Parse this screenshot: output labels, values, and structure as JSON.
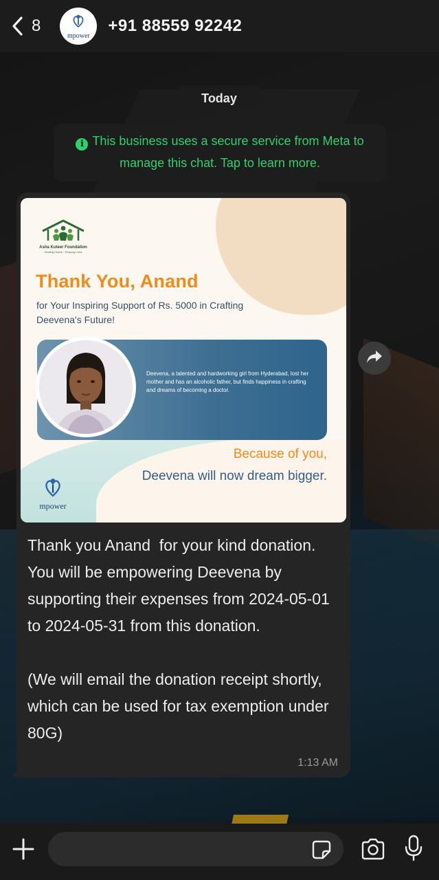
{
  "header": {
    "back_count": "8",
    "avatar_brand": "mpower",
    "title": "+91 88559 92242",
    "icons": {
      "back": "chevron-left-icon",
      "avatar": "mpower-logo-icon"
    }
  },
  "chat": {
    "date_label": "Today",
    "notice": {
      "icon": "info-icon",
      "text": "This business uses a secure service from Meta to manage this chat. Tap to learn more.",
      "color": "#2fd16d"
    },
    "message": {
      "card": {
        "org_name": "Asha Kuteer Foundation",
        "org_tagline": "Healing Hearts · Shaping Lives",
        "heading": "Thank You, Anand",
        "subheading": "for Your Inspiring Support of Rs. 5000 in Crafting Deevena's Future!",
        "story": "Deevena, a talented and hardworking girl from Hyderabad, lost her mother and has an alcoholic father, but finds happiness in crafting and dreams of becoming a doctor.",
        "tagline_line1": "Because of you,",
        "tagline_line2": "Deevena will now dream bigger.",
        "brand": "mpower",
        "accent_color": "#f08a18",
        "blue_color": "#2f5f8a"
      },
      "text": "Thank you Anand  for your kind donation. You will be empowering Deevena by supporting their expenses from 2024-05-01 to 2024-05-31 from this donation.\n\n(We will email the donation receipt shortly, which can be used for tax exemption under 80G)",
      "time": "1:13 AM"
    },
    "forward_icon": "forward-arrow-icon"
  },
  "composer": {
    "placeholder": "",
    "icons": {
      "attach": "plus-icon",
      "sticker": "sticker-icon",
      "camera": "camera-icon",
      "mic": "microphone-icon"
    }
  }
}
